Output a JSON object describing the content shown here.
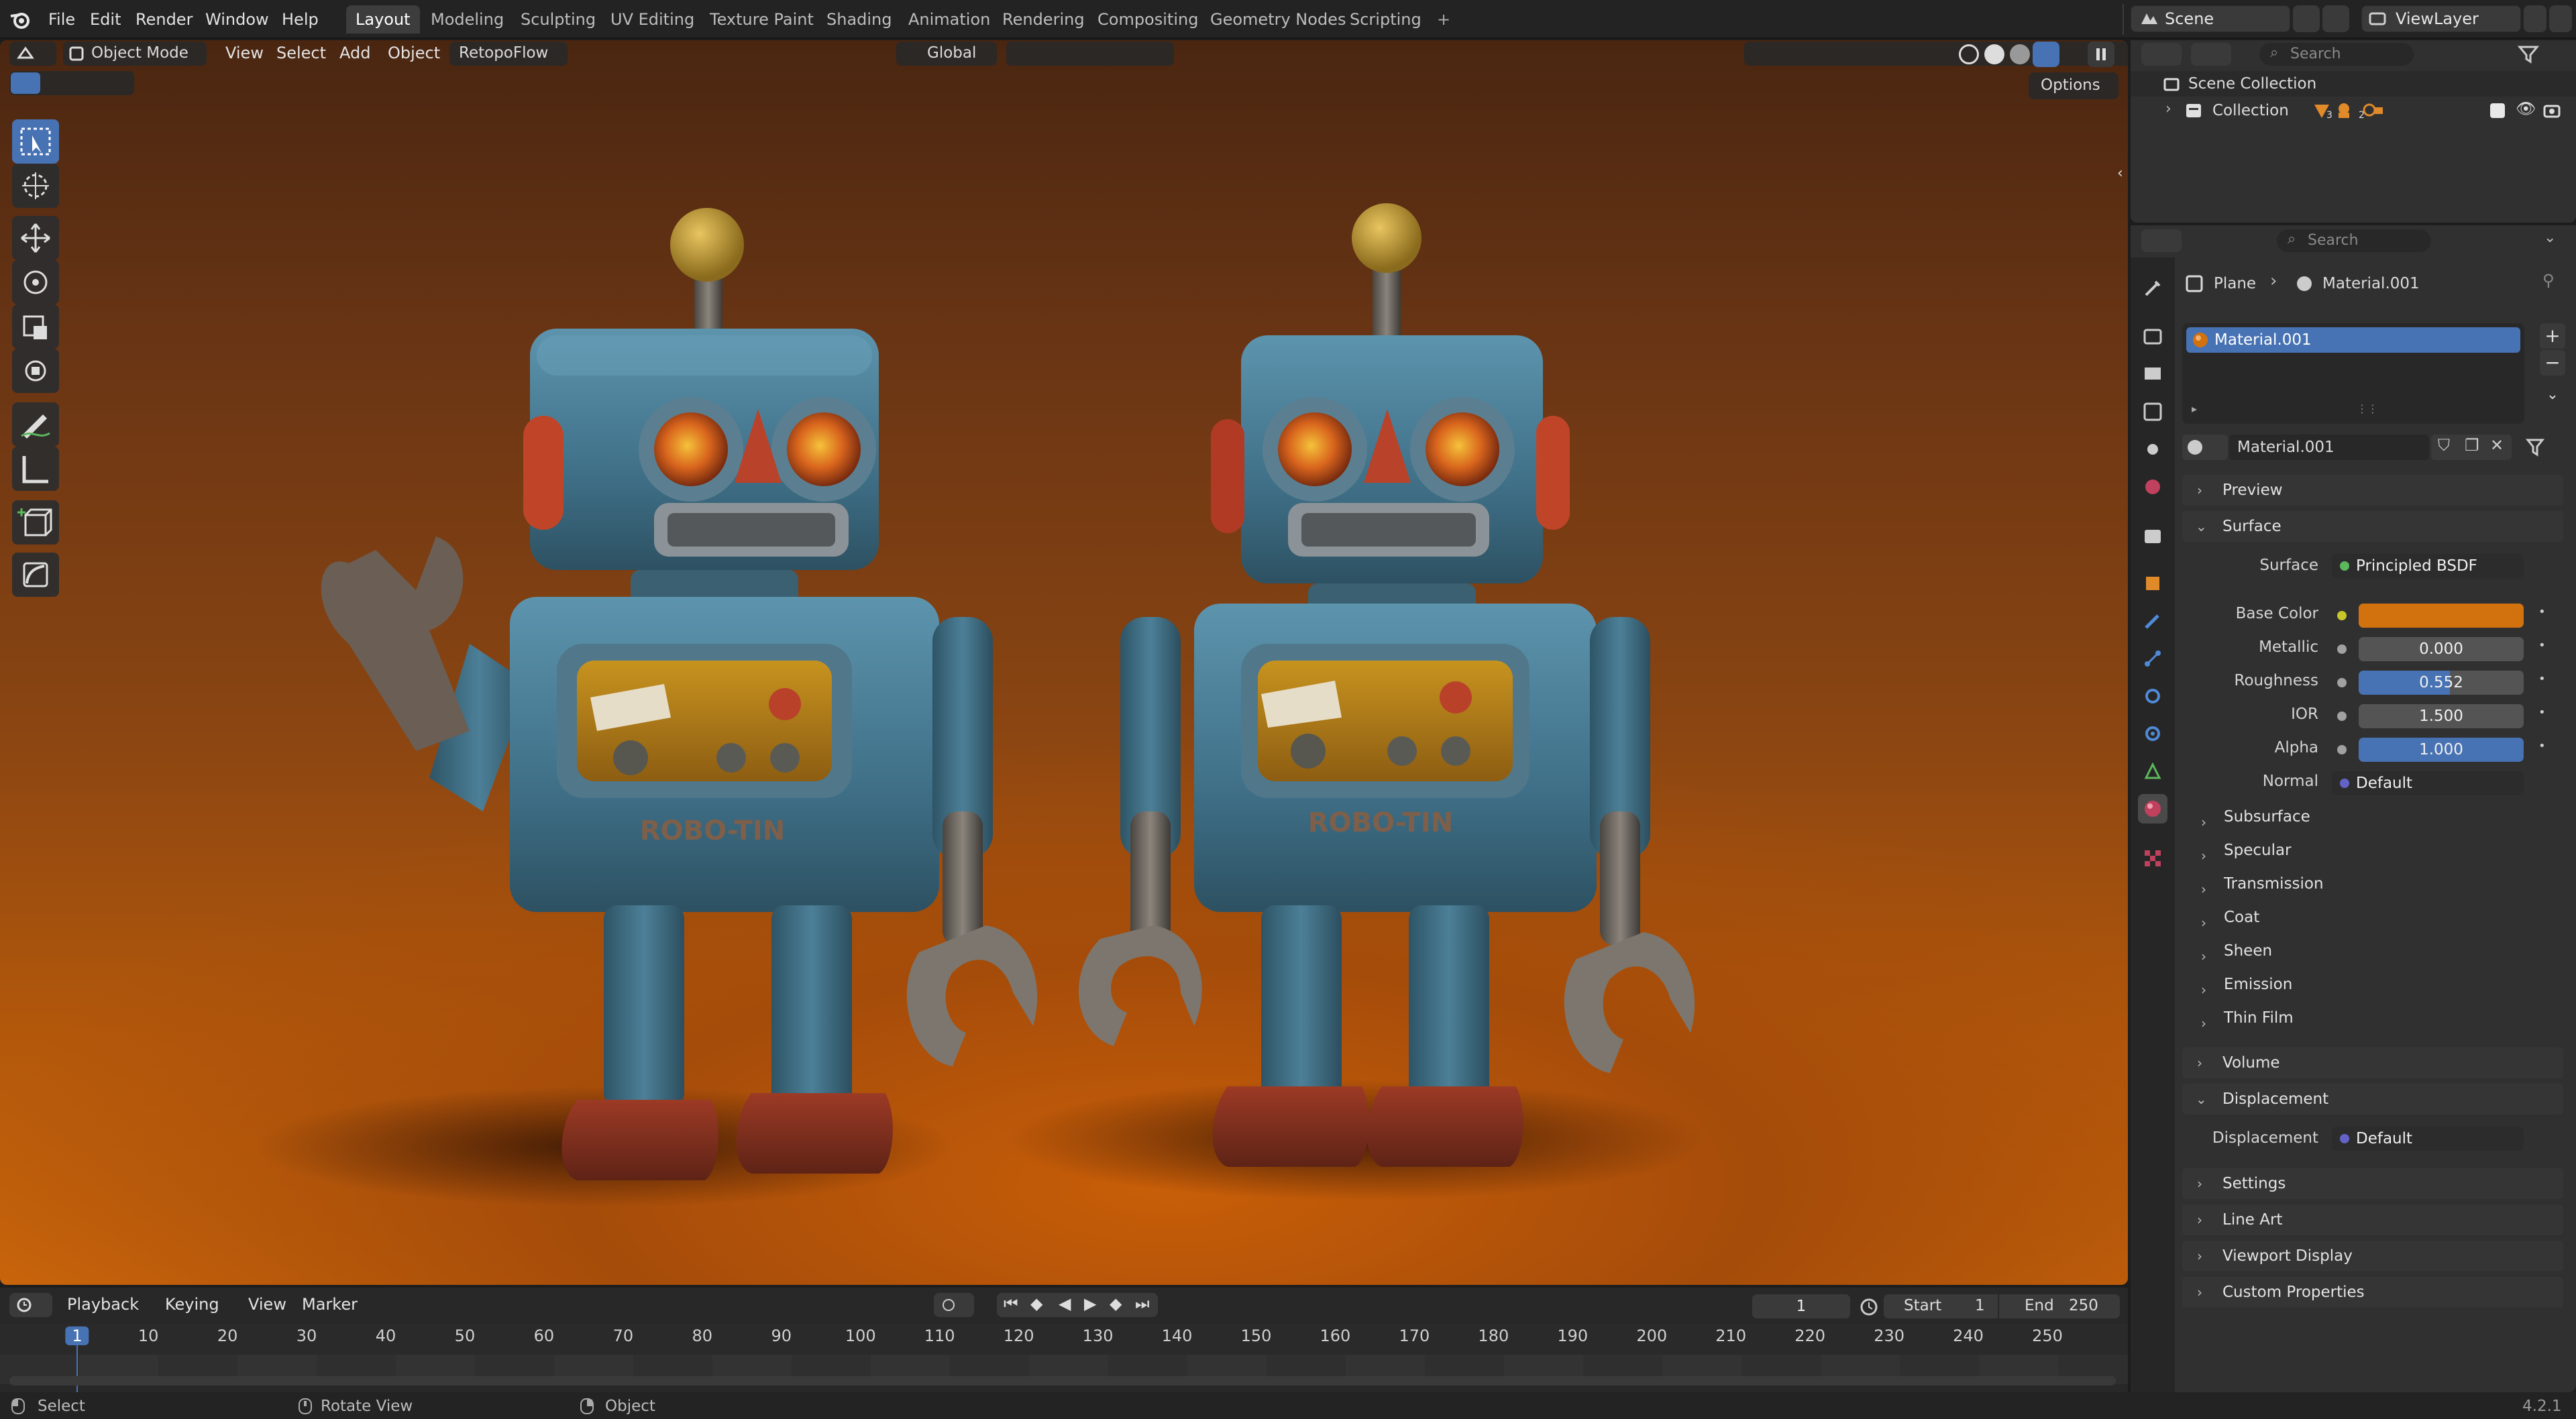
{
  "top_menu": [
    "File",
    "Edit",
    "Render",
    "Window",
    "Help"
  ],
  "workspaces": [
    {
      "label": "Layout",
      "active": true
    },
    {
      "label": "Modeling"
    },
    {
      "label": "Sculpting"
    },
    {
      "label": "UV Editing"
    },
    {
      "label": "Texture Paint"
    },
    {
      "label": "Shading"
    },
    {
      "label": "Animation"
    },
    {
      "label": "Rendering"
    },
    {
      "label": "Compositing"
    },
    {
      "label": "Geometry Nodes"
    },
    {
      "label": "Scripting"
    }
  ],
  "scene_name": "Scene",
  "view_layer": "ViewLayer",
  "viewport_header": {
    "mode": "Object Mode",
    "menus": [
      "View",
      "Select",
      "Add",
      "Object"
    ],
    "addon": "RetopoFlow",
    "orientation": "Global",
    "options": "Options"
  },
  "robots": {
    "left_label": "ROBO-TIN",
    "right_label": "ROBO-TIN"
  },
  "outliner": {
    "search_placeholder": "Search",
    "scene_collection": "Scene Collection",
    "collection": "Collection",
    "badge_1": "3",
    "badge_2": "2"
  },
  "properties": {
    "search_placeholder": "Search",
    "breadcrumb_object": "Plane",
    "breadcrumb_material": "Material.001",
    "slot_name": "Material.001",
    "material_name": "Material.001",
    "sections": {
      "preview": "Preview",
      "surface": "Surface",
      "volume": "Volume",
      "displacement": "Displacement",
      "settings": "Settings",
      "line_art": "Line Art",
      "viewport_display": "Viewport Display",
      "custom_properties": "Custom Properties"
    },
    "surface_label": "Surface",
    "surface_value": "Principled BSDF",
    "params": [
      {
        "label": "Base Color",
        "value": ""
      },
      {
        "label": "Metallic",
        "value": "0.000"
      },
      {
        "label": "Roughness",
        "value": "0.552"
      },
      {
        "label": "IOR",
        "value": "1.500"
      },
      {
        "label": "Alpha",
        "value": "1.000"
      },
      {
        "label": "Normal",
        "value": "Default"
      }
    ],
    "base_color": "#d2720f",
    "subpanels": [
      "Subsurface",
      "Specular",
      "Transmission",
      "Coat",
      "Sheen",
      "Emission",
      "Thin Film"
    ],
    "displacement_label": "Displacement",
    "displacement_value": "Default"
  },
  "timeline": {
    "menus": [
      "Playback",
      "Keying",
      "View",
      "Marker"
    ],
    "current_frame": "1",
    "start_label": "Start",
    "start": "1",
    "end_label": "End",
    "end": "250",
    "ticks": [
      "1",
      "10",
      "20",
      "30",
      "40",
      "50",
      "60",
      "70",
      "80",
      "90",
      "100",
      "110",
      "120",
      "130",
      "140",
      "150",
      "160",
      "170",
      "180",
      "190",
      "200",
      "210",
      "220",
      "230",
      "240",
      "250"
    ]
  },
  "status": {
    "select": "Select",
    "rotate": "Rotate View",
    "object": "Object",
    "version": "4.2.1"
  }
}
